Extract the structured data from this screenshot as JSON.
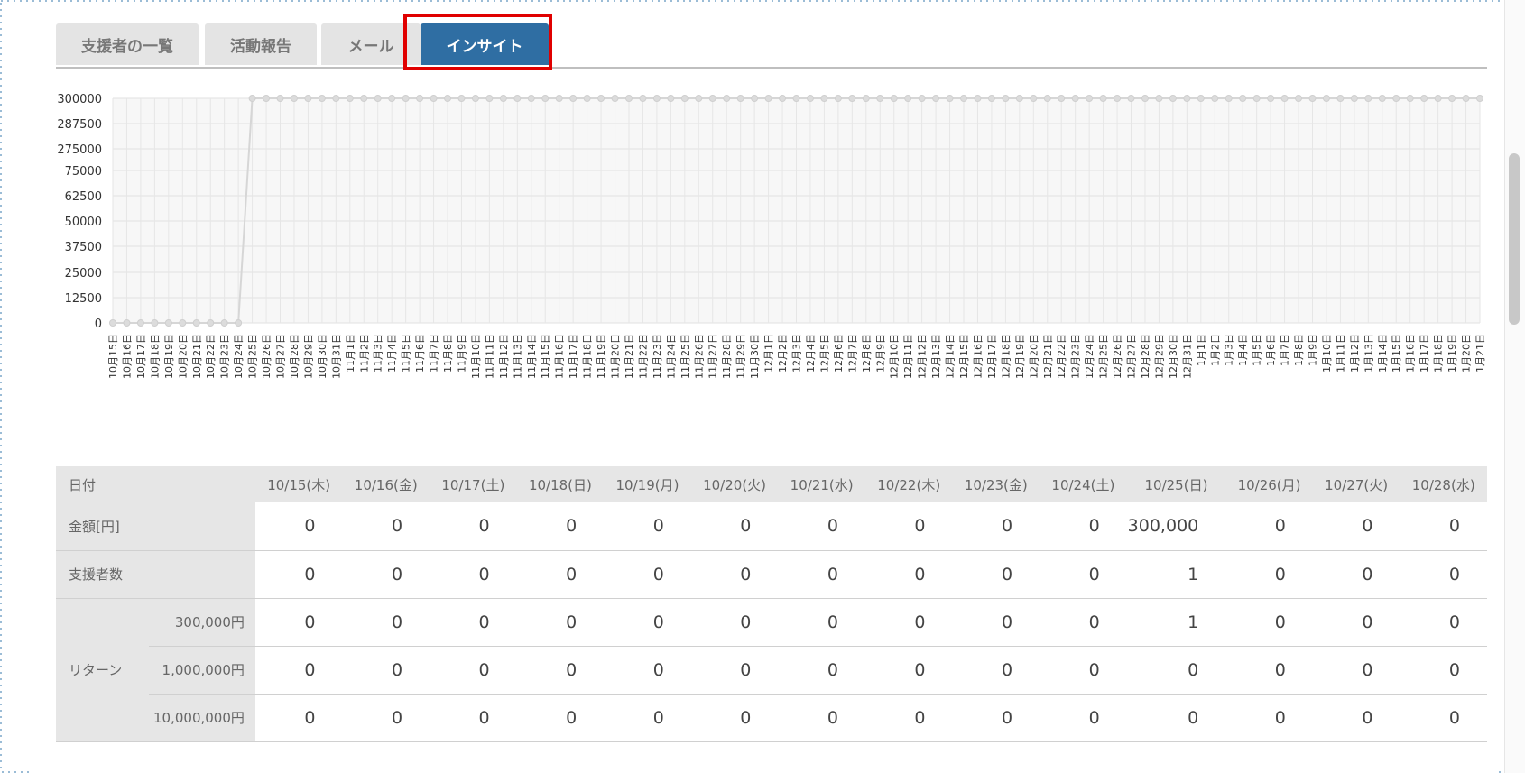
{
  "tabs": [
    {
      "label": "支援者の一覧",
      "active": false
    },
    {
      "label": "活動報告",
      "active": false
    },
    {
      "label": "メール",
      "active": false
    },
    {
      "label": "インサイト",
      "active": true
    }
  ],
  "colors": {
    "active_tab": "#2f6ea3",
    "highlight": "#e00000"
  },
  "chart_data": {
    "type": "line",
    "y_tick_labels": [
      "300000",
      "287500",
      "275000",
      "75000",
      "62500",
      "50000",
      "37500",
      "25000",
      "12500",
      "0"
    ],
    "y_axis_note": "broken axis: upper band 275000–300000, lower band 0–75000",
    "x_labels": [
      "10月15日",
      "10月16日",
      "10月17日",
      "10月18日",
      "10月19日",
      "10月20日",
      "10月21日",
      "10月22日",
      "10月23日",
      "10月24日",
      "10月25日",
      "10月26日",
      "10月27日",
      "10月28日",
      "10月29日",
      "10月30日",
      "10月31日",
      "11月1日",
      "11月2日",
      "11月3日",
      "11月4日",
      "11月5日",
      "11月6日",
      "11月7日",
      "11月8日",
      "11月9日",
      "11月10日",
      "11月11日",
      "11月12日",
      "11月13日",
      "11月14日",
      "11月15日",
      "11月16日",
      "11月17日",
      "11月18日",
      "11月19日",
      "11月20日",
      "11月21日",
      "11月22日",
      "11月23日",
      "11月24日",
      "11月25日",
      "11月26日",
      "11月27日",
      "11月28日",
      "11月29日",
      "11月30日",
      "12月1日",
      "12月2日",
      "12月3日",
      "12月4日",
      "12月5日",
      "12月6日",
      "12月7日",
      "12月8日",
      "12月9日",
      "12月10日",
      "12月11日",
      "12月12日",
      "12月13日",
      "12月14日",
      "12月15日",
      "12月16日",
      "12月17日",
      "12月18日",
      "12月19日",
      "12月20日",
      "12月21日",
      "12月22日",
      "12月23日",
      "12月24日",
      "12月25日",
      "12月26日",
      "12月27日",
      "12月28日",
      "12月29日",
      "12月30日",
      "12月31日",
      "1月1日",
      "1月2日",
      "1月3日",
      "1月4日",
      "1月5日",
      "1月6日",
      "1月7日",
      "1月8日",
      "1月9日",
      "1月10日",
      "1月11日",
      "1月12日",
      "1月13日",
      "1月14日",
      "1月15日",
      "1月16日",
      "1月17日",
      "1月18日",
      "1月19日",
      "1月20日",
      "1月21日"
    ],
    "series": [
      {
        "values_note": "0 for 10/15–10/24, 300000 from 10/25 onward",
        "zero_count": 10,
        "peak_value": 300000
      }
    ]
  },
  "table": {
    "date_header": "日付",
    "dates": [
      "10/15(木)",
      "10/16(金)",
      "10/17(土)",
      "10/18(日)",
      "10/19(月)",
      "10/20(火)",
      "10/21(水)",
      "10/22(木)",
      "10/23(金)",
      "10/24(土)",
      "10/25(日)",
      "10/26(月)",
      "10/27(火)",
      "10/28(水)"
    ],
    "amount_label": "金額[円]",
    "amounts": [
      "0",
      "0",
      "0",
      "0",
      "0",
      "0",
      "0",
      "0",
      "0",
      "0",
      "300,000",
      "0",
      "0",
      "0"
    ],
    "supporters_label": "支援者数",
    "supporters": [
      "0",
      "0",
      "0",
      "0",
      "0",
      "0",
      "0",
      "0",
      "0",
      "0",
      "1",
      "0",
      "0",
      "0"
    ],
    "return_label": "リターン",
    "returns": [
      {
        "label": "300,000円",
        "values": [
          "0",
          "0",
          "0",
          "0",
          "0",
          "0",
          "0",
          "0",
          "0",
          "0",
          "1",
          "0",
          "0",
          "0"
        ]
      },
      {
        "label": "1,000,000円",
        "values": [
          "0",
          "0",
          "0",
          "0",
          "0",
          "0",
          "0",
          "0",
          "0",
          "0",
          "0",
          "0",
          "0",
          "0"
        ]
      },
      {
        "label": "10,000,000円",
        "values": [
          "0",
          "0",
          "0",
          "0",
          "0",
          "0",
          "0",
          "0",
          "0",
          "0",
          "0",
          "0",
          "0",
          "0"
        ]
      }
    ]
  }
}
